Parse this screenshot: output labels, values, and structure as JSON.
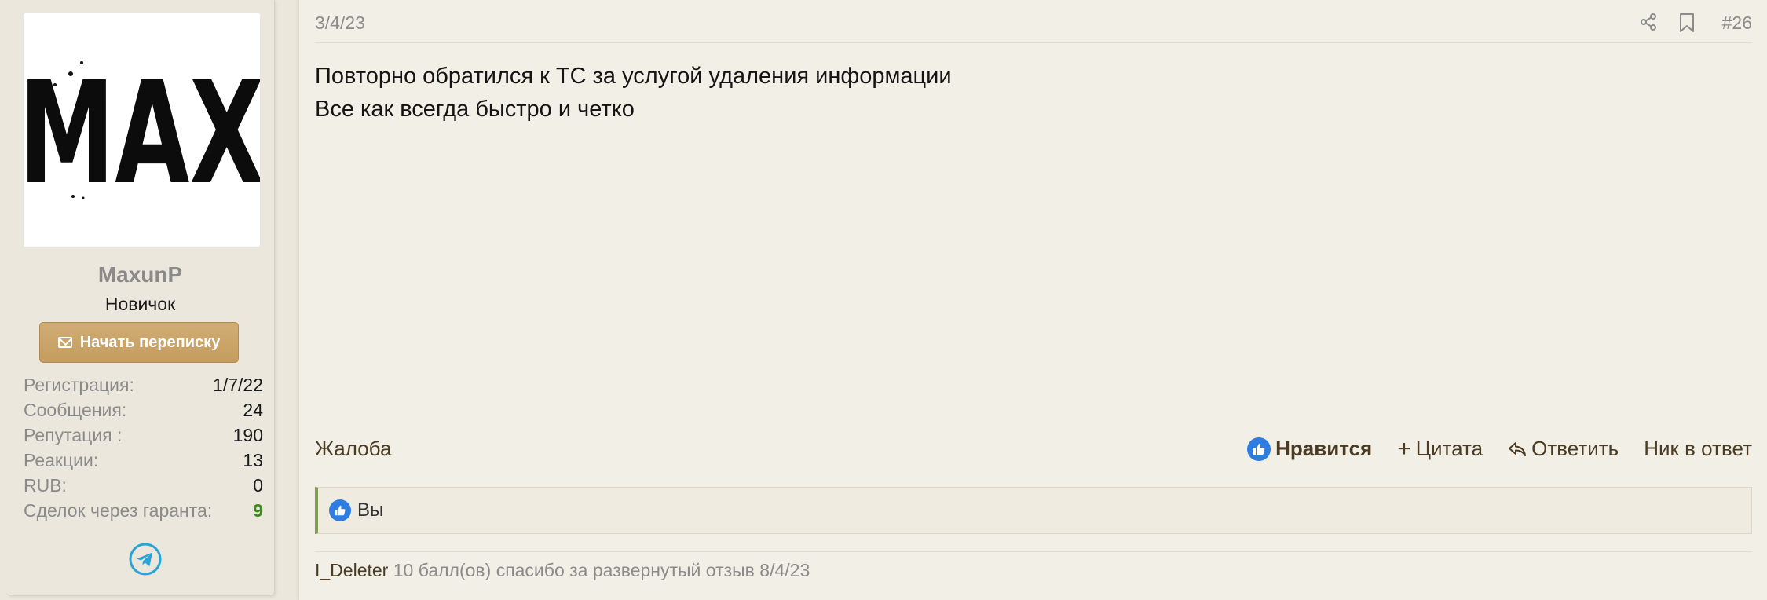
{
  "user": {
    "avatar_text": "MAX",
    "name": "MaxunP",
    "title": "Новичок",
    "start_conversation_label": "Начать переписку",
    "stats": [
      {
        "label": "Регистрация:",
        "value": "1/7/22"
      },
      {
        "label": "Сообщения:",
        "value": "24"
      },
      {
        "label": "Репутация :",
        "value": "190"
      },
      {
        "label": "Реакции:",
        "value": "13"
      },
      {
        "label": "RUB:",
        "value": "0"
      },
      {
        "label": "Сделок через гаранта:",
        "value": "9"
      }
    ],
    "icons": {
      "message": "envelope-icon",
      "contact": "telegram-icon"
    }
  },
  "post": {
    "date": "3/4/23",
    "number": "#26",
    "header_icons": [
      "share-icon",
      "bookmark-icon"
    ],
    "content": [
      "Повторно обратился к ТС за услугой удаления информации",
      "Все как всегда быстро и четко"
    ],
    "actions": {
      "report": "Жалоба",
      "like": "Нравится",
      "quote": "Цитата",
      "reply": "Ответить",
      "nick_reply": "Ник в ответ"
    },
    "reactions": {
      "icon": "thumbs-up-icon",
      "text": "Вы"
    },
    "reputation": {
      "author": "I_Deleter",
      "text": "10 балл(ов) спасибо за развернутый отзыв 8/4/23"
    }
  },
  "colors": {
    "accent_gold": "#c9a469",
    "like_blue": "#2f7de0",
    "deals_green": "#3a8a1a",
    "telegram_blue": "#2aa3d6",
    "reaction_border": "#7f9b54"
  }
}
